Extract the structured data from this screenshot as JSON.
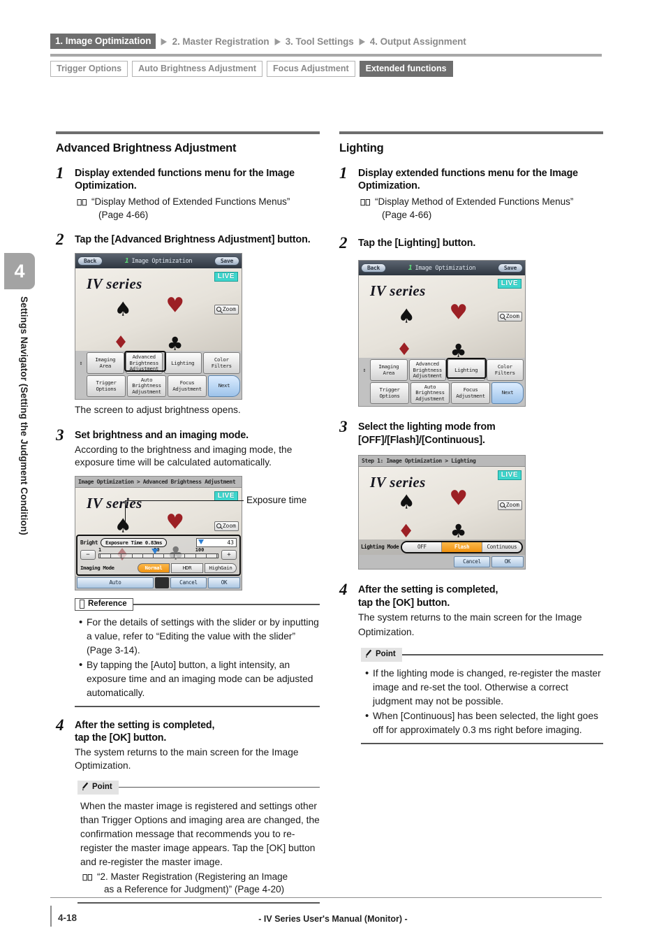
{
  "nav": {
    "breadcrumbs": [
      {
        "label": "1. Image Optimization",
        "active": true
      },
      {
        "label": "2. Master Registration",
        "active": false
      },
      {
        "label": "3. Tool Settings",
        "active": false
      },
      {
        "label": "4. Output Assignment",
        "active": false
      }
    ],
    "arrow": "▶",
    "subtabs": [
      {
        "label": "Trigger Options",
        "active": false
      },
      {
        "label": "Auto Brightness Adjustment",
        "active": false
      },
      {
        "label": "Focus Adjustment",
        "active": false
      },
      {
        "label": "Extended functions",
        "active": true
      }
    ]
  },
  "side_tab": {
    "chapter_number": "4",
    "chapter_title": "Settings Navigator (Setting the Judgment Condition)"
  },
  "left_column": {
    "section_title": "Advanced Brightness Adjustment",
    "step1": {
      "num": "1",
      "heading": "Display extended functions menu for the Image Optimization.",
      "ref_line1": "“Display Method of Extended Functions Menus”",
      "ref_line2": "(Page 4-66)"
    },
    "step2": {
      "num": "2",
      "heading": "Tap the [Advanced Brightness Adjustment] button.",
      "caption": "The screen to adjust brightness opens."
    },
    "step3": {
      "num": "3",
      "heading": "Set brightness and an imaging mode.",
      "body": "According to the brightness and imaging mode, the exposure time will be calculated automatically.",
      "callout": "Exposure time"
    },
    "reference": {
      "tag": "Reference",
      "bullets": [
        "For the details of settings with the slider or by inputting a value, refer to “Editing the value with the slider” (Page 3-14).",
        "By tapping the [Auto] button, a light intensity, an exposure time and an imaging mode can be adjusted automatically."
      ]
    },
    "step4": {
      "num": "4",
      "heading_line1": "After the setting is completed,",
      "heading_line2": "tap the [OK] button.",
      "body": "The system returns to the main screen for the Image Optimization.",
      "point_tag": "Point",
      "point_body": "When the master image is registered and settings other than Trigger Options and imaging area are changed, the confirmation message that recommends you to re-register the master image appears. Tap the [OK] button and re-register the master image.",
      "point_ref_line1": "“2. Master Registration (Registering an Image",
      "point_ref_line2": "as a Reference for Judgment)” (Page 4-20)"
    },
    "figure1": {
      "titlebar": {
        "back": "Back",
        "step": "1",
        "title": "Image Optimization",
        "save": "Save"
      },
      "live_badge": "LIVE",
      "watermark": "IV series",
      "zoom_label": "Zoom",
      "menu_row1": [
        "Imaging Area",
        "Advanced Brightness Adjustment",
        "Lighting",
        "Color Filters"
      ],
      "menu_row2": [
        "Trigger Options",
        "Auto Brightness Adjustment",
        "Focus Adjustment",
        "Next"
      ],
      "selected_button": "Advanced Brightness Adjustment"
    },
    "figure2": {
      "breadcrumb": "Image Optimization > Advanced Brightness Adjustment",
      "live_badge": "LIVE",
      "watermark": "IV series",
      "zoom_label": "Zoom",
      "bright_label": "Bright",
      "exposure_chip": "Exposure Time 0.83ms",
      "value": "43",
      "slider_min": "1",
      "slider_mid": "50",
      "slider_max": "100",
      "minus": "−",
      "plus": "+",
      "imaging_mode_label": "Imaging Mode",
      "imaging_modes": [
        {
          "label": "Normal",
          "selected": true
        },
        {
          "label": "HDR",
          "selected": false
        },
        {
          "label": "HighGain",
          "selected": false
        }
      ],
      "footer": {
        "auto": "Auto",
        "cancel": "Cancel",
        "ok": "OK"
      }
    }
  },
  "right_column": {
    "section_title": "Lighting",
    "step1": {
      "num": "1",
      "heading": "Display extended functions menu for the Image Optimization.",
      "ref_line1": "“Display Method of Extended Functions Menus”",
      "ref_line2": "(Page 4-66)"
    },
    "step2": {
      "num": "2",
      "heading": "Tap the [Lighting] button."
    },
    "step3": {
      "num": "3",
      "heading_line1": "Select the lighting mode from",
      "heading_line2": "[OFF]/[Flash]/[Continuous]."
    },
    "step4": {
      "num": "4",
      "heading_line1": "After the setting is completed,",
      "heading_line2": "tap the [OK] button.",
      "body": "The system returns to the main screen for the Image Optimization.",
      "point_tag": "Point",
      "point_bullets": [
        "If the lighting mode is changed, re-register the master image and re-set the tool. Otherwise a correct judgment may not be possible.",
        "When [Continuous] has been selected, the light goes off for approximately 0.3 ms right before imaging."
      ]
    },
    "figure1": {
      "titlebar": {
        "back": "Back",
        "step": "1",
        "title": "Image Optimization",
        "save": "Save"
      },
      "live_badge": "LIVE",
      "watermark": "IV series",
      "zoom_label": "Zoom",
      "menu_row1": [
        "Imaging Area",
        "Advanced Brightness Adjustment",
        "Lighting",
        "Color Filters"
      ],
      "menu_row2": [
        "Trigger Options",
        "Auto Brightness Adjustment",
        "Focus Adjustment",
        "Next"
      ],
      "selected_button": "Lighting"
    },
    "figure2": {
      "breadcrumb": "Step 1: Image Optimization > Lighting",
      "live_badge": "LIVE",
      "watermark": "IV series",
      "zoom_label": "Zoom",
      "lighting_mode_label": "Lighting Mode",
      "modes": [
        {
          "label": "OFF",
          "selected": false
        },
        {
          "label": "Flash",
          "selected": true
        },
        {
          "label": "Continuous",
          "selected": false
        }
      ],
      "footer": {
        "cancel": "Cancel",
        "ok": "OK"
      }
    }
  },
  "footer": {
    "page_number": "4-18",
    "manual_title": "- IV Series User's Manual (Monitor) -"
  },
  "colors": {
    "accent_active": "#6e6e6e",
    "live_badge": "#3ed6cd",
    "selected_segment": "#f09210",
    "heart_red": "#9c2025"
  }
}
